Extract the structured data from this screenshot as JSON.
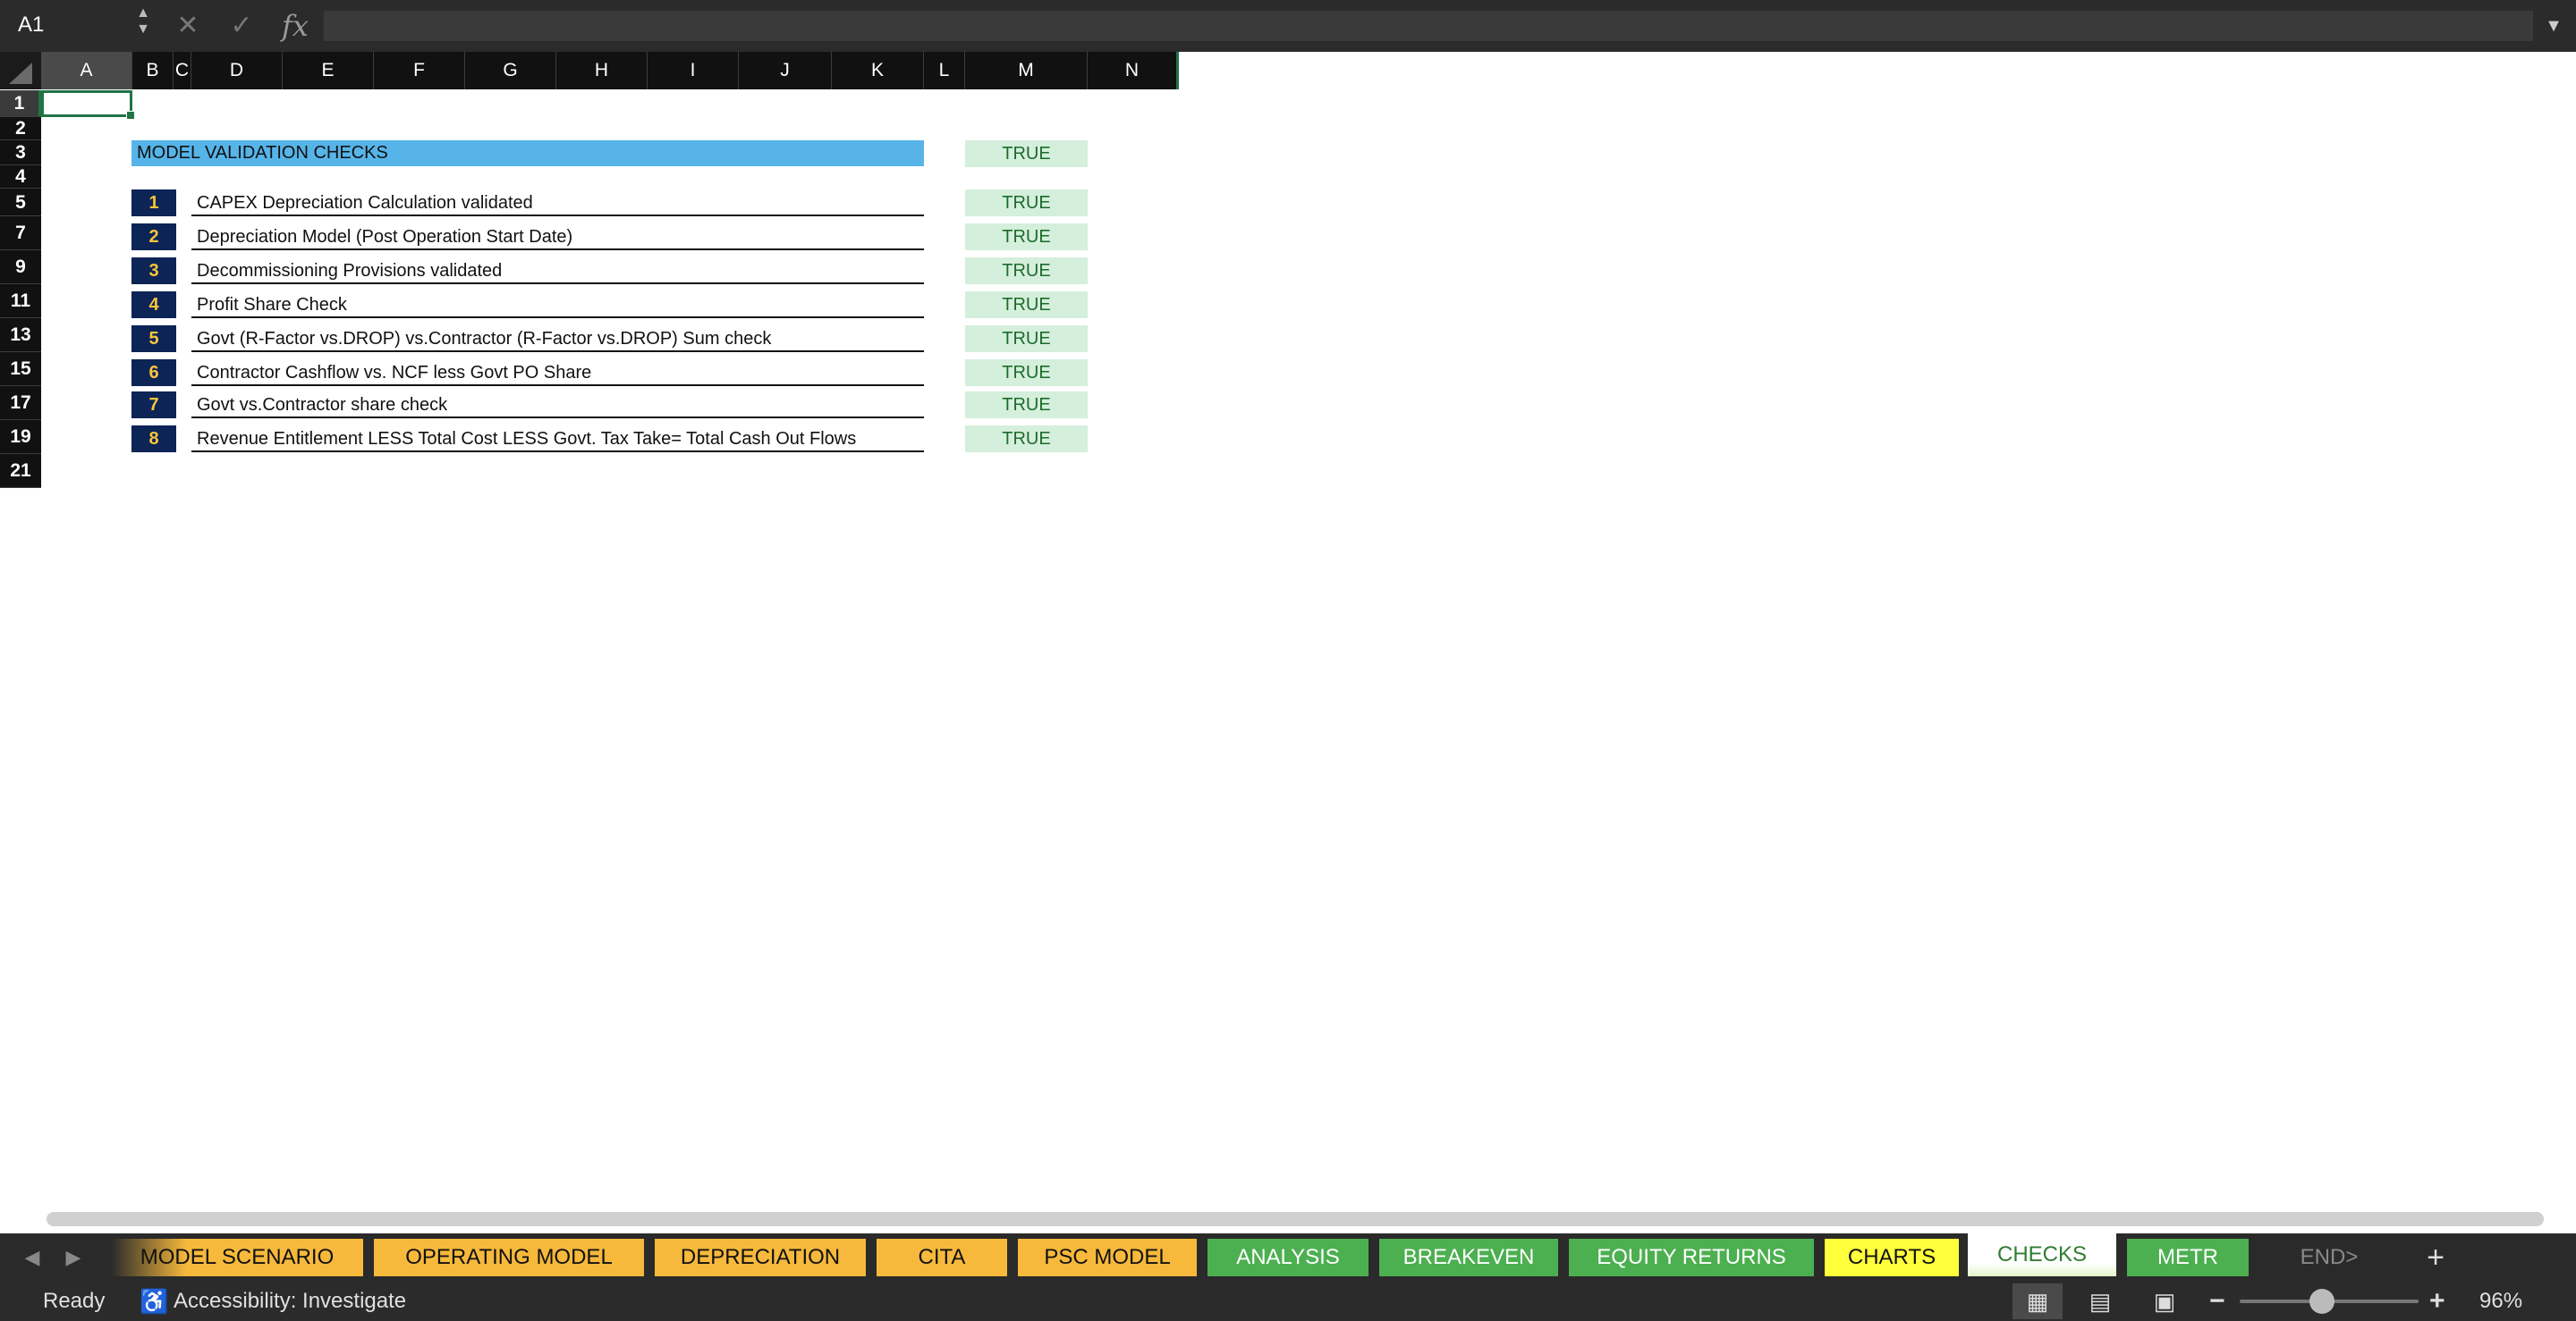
{
  "formula_bar": {
    "name_box": "A1",
    "cancel_icon": "✕",
    "enter_icon": "✓",
    "fx_label": "fx",
    "formula_value": ""
  },
  "columns": [
    "A",
    "B",
    "C",
    "D",
    "E",
    "F",
    "G",
    "H",
    "I",
    "J",
    "K",
    "L",
    "M",
    "N"
  ],
  "rows": [
    "1",
    "2",
    "3",
    "4",
    "5",
    "7",
    "9",
    "11",
    "13",
    "15",
    "17",
    "19",
    "21"
  ],
  "sheet": {
    "title": "MODEL VALIDATION CHECKS",
    "title_result": "TRUE",
    "checks": [
      {
        "num": "1",
        "label": "CAPEX Depreciation Calculation validated",
        "result": "TRUE"
      },
      {
        "num": "2",
        "label": "Depreciation Model (Post Operation Start Date)",
        "result": "TRUE"
      },
      {
        "num": "3",
        "label": "Decommissioning Provisions validated",
        "result": "TRUE"
      },
      {
        "num": "4",
        "label": "Profit Share Check",
        "result": "TRUE"
      },
      {
        "num": "5",
        "label": "Govt (R-Factor vs.DROP) vs.Contractor  (R-Factor vs.DROP) Sum check",
        "result": "TRUE"
      },
      {
        "num": "6",
        "label": "Contractor Cashflow vs. NCF less Govt PO  Share",
        "result": "TRUE"
      },
      {
        "num": "7",
        "label": "Govt vs.Contractor share check",
        "result": "TRUE"
      },
      {
        "num": "8",
        "label": "Revenue Entitlement LESS Total Cost LESS Govt. Tax Take= Total Cash Out Flows",
        "result": "TRUE"
      }
    ]
  },
  "tabs": [
    {
      "label": "MODEL SCENARIO",
      "color": "#f6b93b"
    },
    {
      "label": "OPERATING MODEL",
      "color": "#f6b93b"
    },
    {
      "label": "DEPRECIATION",
      "color": "#f6b93b"
    },
    {
      "label": "CITA",
      "color": "#f6b93b"
    },
    {
      "label": "PSC MODEL",
      "color": "#f6b93b"
    },
    {
      "label": "ANALYSIS",
      "color": "#4caf50"
    },
    {
      "label": "BREAKEVEN",
      "color": "#4caf50"
    },
    {
      "label": "EQUITY RETURNS",
      "color": "#4caf50"
    },
    {
      "label": "CHARTS",
      "color": "#ffff3b"
    },
    {
      "label": "CHECKS",
      "color": "#ffffff"
    },
    {
      "label": "METR",
      "color": "#4caf50"
    },
    {
      "label": "END>",
      "color": "#2a2a2a"
    }
  ],
  "tab_nav": {
    "prev": "◀",
    "next": "▶",
    "add": "+"
  },
  "status": {
    "ready": "Ready",
    "accessibility": "Accessibility: Investigate",
    "zoom_minus": "−",
    "zoom_plus": "+",
    "zoom": "96%"
  }
}
